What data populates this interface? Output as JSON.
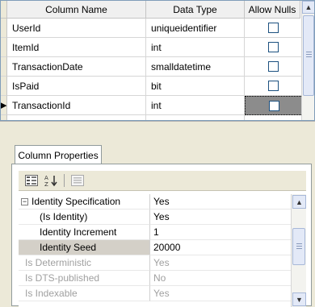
{
  "grid": {
    "columns": [
      "Column Name",
      "Data Type",
      "Allow Nulls"
    ],
    "rows": [
      {
        "name": "UserId",
        "type": "uniqueidentifier",
        "allow_nulls": false
      },
      {
        "name": "ItemId",
        "type": "int",
        "allow_nulls": false
      },
      {
        "name": "TransactionDate",
        "type": "smalldatetime",
        "allow_nulls": false
      },
      {
        "name": "IsPaid",
        "type": "bit",
        "allow_nulls": false
      },
      {
        "name": "TransactionId",
        "type": "int",
        "allow_nulls": false,
        "selected": true
      }
    ],
    "scroll_up_icon": "scroll-up-arrow-icon",
    "row_marker_icon": "primary-key-arrow-icon"
  },
  "properties": {
    "tab_label": "Column Properties",
    "toolbar": {
      "categorized_icon": "categorized-icon",
      "alphabetical_icon": "alphabetical-sort-icon",
      "property_pages_icon": "property-pages-icon"
    },
    "rows": [
      {
        "name": "Identity Specification",
        "value": "Yes",
        "expandable": true,
        "indent": false,
        "disabled": false,
        "selected": false
      },
      {
        "name": "(Is Identity)",
        "value": "Yes",
        "expandable": false,
        "indent": true,
        "disabled": false,
        "selected": false
      },
      {
        "name": "Identity Increment",
        "value": "1",
        "expandable": false,
        "indent": true,
        "disabled": false,
        "selected": false
      },
      {
        "name": "Identity Seed",
        "value": "20000",
        "expandable": false,
        "indent": true,
        "disabled": false,
        "selected": true
      },
      {
        "name": "Is Deterministic",
        "value": "Yes",
        "expandable": false,
        "indent": false,
        "disabled": true,
        "selected": false
      },
      {
        "name": "Is DTS-published",
        "value": "No",
        "expandable": false,
        "indent": false,
        "disabled": true,
        "selected": false
      },
      {
        "name": "Is Indexable",
        "value": "Yes",
        "expandable": false,
        "indent": false,
        "disabled": true,
        "selected": false
      }
    ],
    "expander_symbol": "−"
  }
}
